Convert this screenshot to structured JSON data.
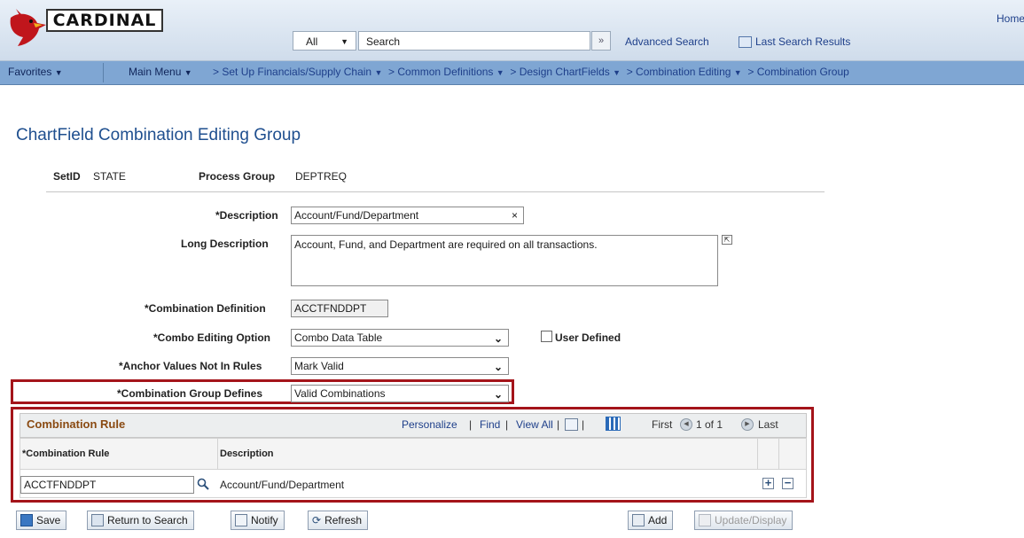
{
  "header": {
    "logo_text": "CARDINAL",
    "home_link": "Home",
    "search_category": "All",
    "search_placeholder": "Search",
    "advanced_search": "Advanced Search",
    "last_search_results": "Last Search Results"
  },
  "nav": {
    "favorites": "Favorites",
    "main_menu": "Main Menu",
    "breadcrumbs": [
      "Set Up Financials/Supply Chain",
      "Common Definitions",
      "Design ChartFields",
      "Combination Editing",
      "Combination Group"
    ]
  },
  "page": {
    "title": "ChartField Combination Editing Group",
    "setid_label": "SetID",
    "setid_value": "STATE",
    "process_group_label": "Process Group",
    "process_group_value": "DEPTREQ"
  },
  "form": {
    "description_label": "*Description",
    "description_value": "Account/Fund/Department",
    "long_description_label": "Long Description",
    "long_description_value": "Account, Fund, and Department are required on all transactions.",
    "combination_definition_label": "*Combination Definition",
    "combination_definition_value": "ACCTFNDDPT",
    "combo_editing_option_label": "*Combo Editing Option",
    "combo_editing_option_value": "Combo Data Table",
    "user_defined_label": "User Defined",
    "anchor_values_label": "*Anchor Values Not In Rules",
    "anchor_values_value": "Mark Valid",
    "combination_group_defines_label": "*Combination Group Defines",
    "combination_group_defines_value": "Valid Combinations"
  },
  "grid": {
    "title": "Combination Rule",
    "personalize": "Personalize",
    "find": "Find",
    "view_all": "View All",
    "first": "First",
    "pager": "1 of 1",
    "last": "Last",
    "col_rule": "*Combination Rule",
    "col_description": "Description",
    "rows": [
      {
        "rule": "ACCTFNDDPT",
        "description": "Account/Fund/Department"
      }
    ]
  },
  "toolbar": {
    "save": "Save",
    "return_to_search": "Return to Search",
    "notify": "Notify",
    "refresh": "Refresh",
    "add": "Add",
    "update_display": "Update/Display"
  },
  "colors": {
    "highlight": "#a4141a",
    "nav_bar": "#7fa6d3",
    "title_blue": "#1f4f8f",
    "grid_title": "#8a4a12"
  }
}
